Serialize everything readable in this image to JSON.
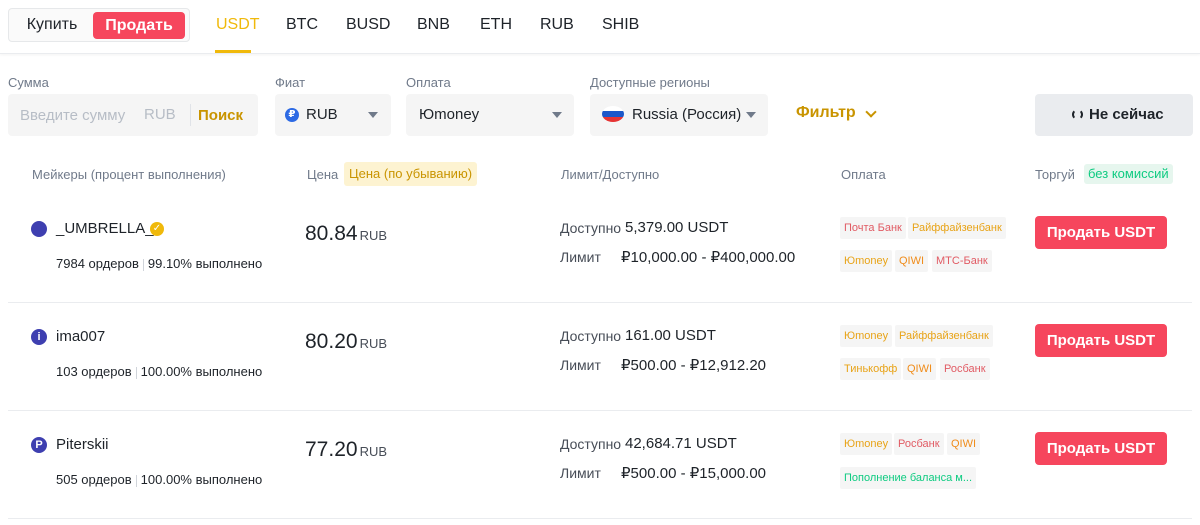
{
  "trade_toggle": {
    "buy_label": "Купить",
    "sell_label": "Продать"
  },
  "asset_tabs": [
    {
      "label": "USDT",
      "active": true
    },
    {
      "label": "BTC"
    },
    {
      "label": "BUSD"
    },
    {
      "label": "BNB"
    },
    {
      "label": "ETH"
    },
    {
      "label": "RUB"
    },
    {
      "label": "SHIB"
    }
  ],
  "filters": {
    "amount": {
      "label": "Сумма",
      "placeholder": "Введите сумму",
      "currency": "RUB",
      "search_label": "Поиск"
    },
    "fiat": {
      "label": "Фиат",
      "value": "RUB",
      "icon": "ruble-coin-icon"
    },
    "payment": {
      "label": "Оплата",
      "value": "Юmoney"
    },
    "region": {
      "label": "Доступные регионы",
      "value": "Russia (Россия)",
      "icon": "russia-flag-icon"
    },
    "filter_label": "Фильтр",
    "refresh_label": "Не сейчас"
  },
  "table_header": {
    "makers": "Мейкеры (процент выполнения)",
    "price": "Цена",
    "price_sort": "Цена (по убыванию)",
    "limit": "Лимит/Доступно",
    "payment": "Оплата",
    "trade": "Торгуй",
    "no_fee": "без комиссий"
  },
  "colors": {
    "accent": "#f0b90b",
    "sell": "#f6465d",
    "green": "#0ecb81"
  },
  "rows": [
    {
      "name": "_UMBRELLA_",
      "avatar": "",
      "verified": true,
      "orders": "7984 ордеров",
      "completion": "99.10% выполнено",
      "price": "80.84",
      "price_unit": "RUB",
      "available_label": "Доступно",
      "available": "5,379.00 USDT",
      "limit_label": "Лимит",
      "limit": "₽10,000.00 - ₽400,000.00",
      "payments": [
        {
          "label": "Почта Банк",
          "color": "#e15b64"
        },
        {
          "label": "Райффайзенбанк",
          "color": "#e8a317"
        },
        {
          "label": "Юmoney",
          "color": "#e8a317"
        },
        {
          "label": "QIWI",
          "color": "#f08c1a"
        },
        {
          "label": "МТС-Банк",
          "color": "#e15b64"
        }
      ],
      "action": "Продать USDT"
    },
    {
      "name": "ima007",
      "avatar": "i",
      "verified": false,
      "orders": "103 ордеров",
      "completion": "100.00% выполнено",
      "price": "80.20",
      "price_unit": "RUB",
      "available_label": "Доступно",
      "available": "161.00 USDT",
      "limit_label": "Лимит",
      "limit": "₽500.00 - ₽12,912.20",
      "payments": [
        {
          "label": "Юmoney",
          "color": "#e8a317"
        },
        {
          "label": "Райффайзенбанк",
          "color": "#e8a317"
        },
        {
          "label": "Тинькофф",
          "color": "#e8a317"
        },
        {
          "label": "QIWI",
          "color": "#f08c1a"
        },
        {
          "label": "Росбанк",
          "color": "#e15b64"
        }
      ],
      "action": "Продать USDT"
    },
    {
      "name": "Piterskii",
      "avatar": "P",
      "verified": false,
      "orders": "505 ордеров",
      "completion": "100.00% выполнено",
      "price": "77.20",
      "price_unit": "RUB",
      "available_label": "Доступно",
      "available": "42,684.71 USDT",
      "limit_label": "Лимит",
      "limit": "₽500.00 - ₽15,000.00",
      "payments": [
        {
          "label": "Юmoney",
          "color": "#e8a317"
        },
        {
          "label": "Росбанк",
          "color": "#e15b64"
        },
        {
          "label": "QIWI",
          "color": "#f08c1a"
        },
        {
          "label": "Пополнение баланса м...",
          "color": "#0ecb81"
        }
      ],
      "action": "Продать USDT"
    }
  ]
}
